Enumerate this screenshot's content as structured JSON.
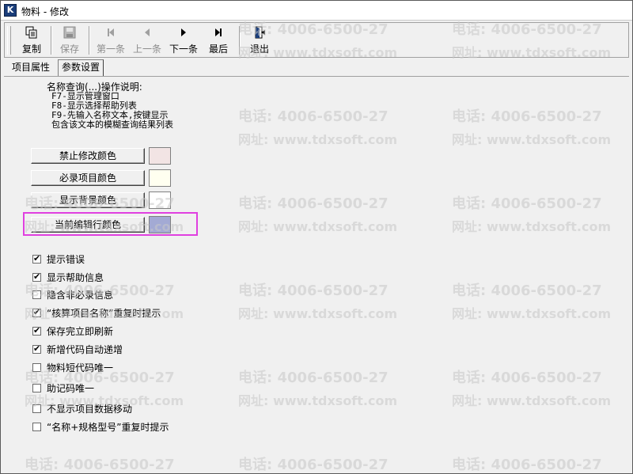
{
  "window": {
    "title": "物料 - 修改"
  },
  "toolbar": {
    "copy": "复制",
    "save": "保存",
    "first": "第一条",
    "prev": "上一条",
    "next": "下一条",
    "last": "最后",
    "exit": "退出"
  },
  "tabs": [
    {
      "label": "项目属性",
      "active": false
    },
    {
      "label": "参数设置",
      "active": true
    }
  ],
  "instructions": {
    "heading": "名称查询(...)操作说明:",
    "line1": "F7-显示管理窗口",
    "line2": "F8-显示选择帮助列表",
    "line3": "F9-先输入名称文本,按键显示",
    "line4": "包含该文本的模糊查询结果列表"
  },
  "color_settings": [
    {
      "label": "禁止修改颜色",
      "color": "#f2e4e4"
    },
    {
      "label": "必录项目颜色",
      "color": "#fffff0"
    },
    {
      "label": "显示背景颜色",
      "color": "#ffffff"
    },
    {
      "label": "当前编辑行颜色",
      "color": "#a3aad4"
    }
  ],
  "options": [
    {
      "label": "提示错误",
      "checked": true
    },
    {
      "label": "显示帮助信息",
      "checked": true
    },
    {
      "label": "隐含非必录信息",
      "checked": false
    },
    {
      "label": "“核算项目名称”重复时提示",
      "checked": true
    },
    {
      "label": "保存完立即刷新",
      "checked": true
    },
    {
      "label": "新增代码自动递增",
      "checked": true
    },
    {
      "label": "物料短代码唯一",
      "checked": false
    },
    {
      "label": "助记码唯一",
      "checked": false
    },
    {
      "label": "不显示项目数据移动",
      "checked": false
    },
    {
      "label": "“名称+规格型号”重复时提示",
      "checked": false
    }
  ],
  "watermark": {
    "phone": "电话: 4006-6500-27",
    "site": "网址: www.tdxsoft.com"
  },
  "colors": {
    "highlight": "#e040e0"
  }
}
